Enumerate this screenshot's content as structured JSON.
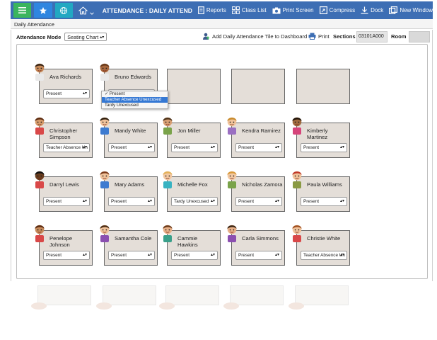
{
  "toolbar": {
    "title": "ATTENDANCE : DAILY ATTENDANC",
    "items": [
      "Reports",
      "Class List",
      "Print Screen",
      "Compress",
      "Dock",
      "New Window"
    ]
  },
  "subheader": "Daily Attendance",
  "controls": {
    "mode_label": "Attendance Mode",
    "mode_value": "Seating Chart",
    "add_tile": "Add Daily Attendance Tile to Dashboard",
    "print": "Print",
    "sections_label": "Sections",
    "sections_value": "03101A000",
    "room_label": "Room",
    "room_value": ""
  },
  "seats": [
    {
      "name": "Ava Richards",
      "status": "Present",
      "hair": "#3a2412",
      "skin": "#c68a5a",
      "shirt": "#e9e9e9"
    },
    {
      "name": "Bruno Edwards",
      "status": "",
      "hair": "#6a3a1a",
      "skin": "#a8683e",
      "shirt": "#e9e9e9"
    },
    {
      "name": "",
      "status": ""
    },
    {
      "name": "",
      "status": ""
    },
    {
      "name": "",
      "status": ""
    },
    {
      "name": "Christopher Simpson",
      "status": "Teacher Absence Un",
      "hair": "#5a2a10",
      "skin": "#d59a6a",
      "shirt": "#d94848"
    },
    {
      "name": "Mandy White",
      "status": "Present",
      "hair": "#2a1a0a",
      "skin": "#f0c29a",
      "shirt": "#3d7bd0"
    },
    {
      "name": "Jon Miller",
      "status": "Present",
      "hair": "#4a3018",
      "skin": "#d9a074",
      "shirt": "#7aa34a"
    },
    {
      "name": "Kendra Ramirez",
      "status": "Present",
      "hair": "#c78a2a",
      "skin": "#f0c29a",
      "shirt": "#9a6fc2"
    },
    {
      "name": "Kimberly Martinez",
      "status": "Present",
      "hair": "#1e1208",
      "skin": "#a06a3e",
      "shirt": "#d6447a"
    },
    {
      "name": "Darryl Lewis",
      "status": "Present",
      "hair": "#111111",
      "skin": "#6a3d1e",
      "shirt": "#d94848"
    },
    {
      "name": "Mary Adams",
      "status": "Present",
      "hair": "#7a3a1a",
      "skin": "#f0c29a",
      "shirt": "#3d7bd0"
    },
    {
      "name": "Michelle Fox",
      "status": "Tardy Unexcused",
      "hair": "#e3b25a",
      "skin": "#f2c8a2",
      "shirt": "#38b3c2"
    },
    {
      "name": "Nicholas Zamora",
      "status": "Present",
      "hair": "#d99a3a",
      "skin": "#f2c8a2",
      "shirt": "#7aa34a"
    },
    {
      "name": "Paula Williams",
      "status": "Present",
      "hair": "#c03a2a",
      "skin": "#f0c29a",
      "shirt": "#8a9a44"
    },
    {
      "name": "Penelope Johnson",
      "status": "Present",
      "hair": "#5a2a10",
      "skin": "#c68a5a",
      "shirt": "#d94848"
    },
    {
      "name": "Samantha Cole",
      "status": "Present",
      "hair": "#4a2a12",
      "skin": "#f0c29a",
      "shirt": "#8b4fb0"
    },
    {
      "name": "Cammie Hawkins",
      "status": "Present",
      "hair": "#6a3a1a",
      "skin": "#e8b088",
      "shirt": "#3aa08a"
    },
    {
      "name": "Carla Simmons",
      "status": "Present",
      "hair": "#3a2412",
      "skin": "#e8b088",
      "shirt": "#8b4fb0"
    },
    {
      "name": "Christie White",
      "status": "Teacher Absence Un",
      "hair": "#a05020",
      "skin": "#f0c29a",
      "shirt": "#d94848"
    }
  ],
  "dropdown": {
    "options": [
      "✓ Present",
      "Teacher Absence Unexcused",
      "Tardy Unexcused"
    ],
    "highlighted": 1
  },
  "colors": {
    "toolbar": "#3d6eb4",
    "green": "#3bb55e",
    "blue": "#2f86e0",
    "teal": "#22a8c2",
    "seat": "#e4ded8",
    "highlight": "#3478d4"
  }
}
